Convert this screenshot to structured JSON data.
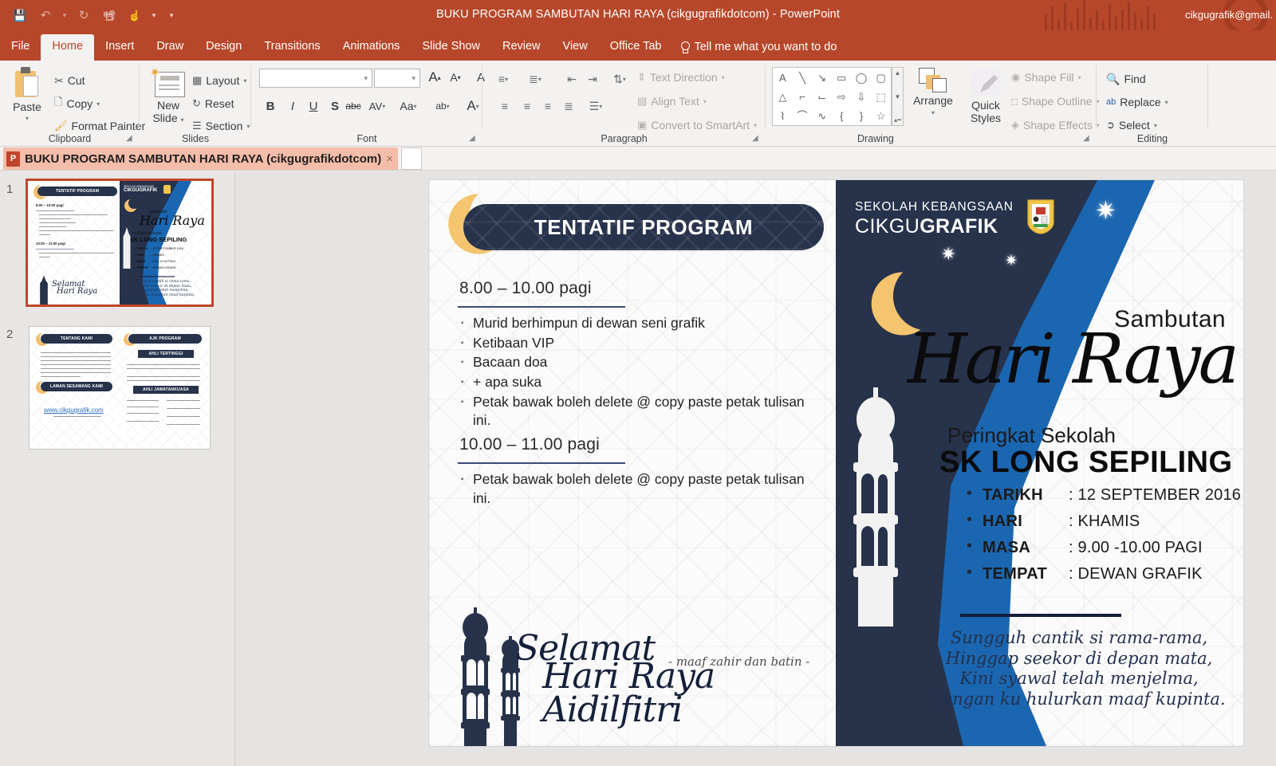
{
  "titlebar": {
    "document_title": "BUKU PROGRAM SAMBUTAN HARI RAYA (cikgugrafikdotcom)  -  PowerPoint",
    "account": "cikgugrafik@gmail.",
    "qat": [
      {
        "name": "save-icon",
        "glyph": "💾"
      },
      {
        "name": "undo-icon",
        "glyph": "↶"
      },
      {
        "name": "undo-dropdown-icon",
        "glyph": "▾"
      },
      {
        "name": "redo-icon",
        "glyph": "↻"
      },
      {
        "name": "start-slideshow-icon",
        "glyph": "⌨"
      },
      {
        "name": "touch-mode-icon",
        "glyph": "☝"
      },
      {
        "name": "touch-dropdown-icon",
        "glyph": "▾"
      },
      {
        "name": "customize-qat-icon",
        "glyph": "‗"
      }
    ]
  },
  "tabs": [
    {
      "label": "File",
      "active": false
    },
    {
      "label": "Home",
      "active": true
    },
    {
      "label": "Insert",
      "active": false
    },
    {
      "label": "Draw",
      "active": false
    },
    {
      "label": "Design",
      "active": false
    },
    {
      "label": "Transitions",
      "active": false
    },
    {
      "label": "Animations",
      "active": false
    },
    {
      "label": "Slide Show",
      "active": false
    },
    {
      "label": "Review",
      "active": false
    },
    {
      "label": "View",
      "active": false
    },
    {
      "label": "Office Tab",
      "active": false
    }
  ],
  "tellme": "Tell me what you want to do",
  "ribbon": {
    "clipboard": {
      "group_label": "Clipboard",
      "paste_label": "Paste",
      "cut_label": "Cut",
      "copy_label": "Copy",
      "format_painter_label": "Format Painter"
    },
    "slides": {
      "group_label": "Slides",
      "new_slide_label_line1": "New",
      "new_slide_label_line2": "Slide",
      "layout_label": "Layout",
      "reset_label": "Reset",
      "section_label": "Section"
    },
    "font": {
      "group_label": "Font",
      "font_name_value": "",
      "font_size_value": "",
      "increase_font_label": "A",
      "decrease_font_label": "A",
      "clear_formatting_label": "A",
      "bold_label": "B",
      "italic_label": "I",
      "underline_label": "U",
      "shadow_label": "S",
      "strikethrough_label": "abc",
      "character_spacing_label": "AV",
      "change_case_label": "Aa",
      "text_highlight_label": "ab",
      "font_color_label": "A"
    },
    "paragraph": {
      "group_label": "Paragraph",
      "text_direction_label": "Text Direction",
      "align_text_label": "Align Text",
      "convert_smartart_label": "Convert to SmartArt"
    },
    "drawing": {
      "group_label": "Drawing",
      "arrange_label": "Arrange",
      "quick_styles_line1": "Quick",
      "quick_styles_line2": "Styles",
      "shape_fill_label": "Shape Fill",
      "shape_outline_label": "Shape Outline",
      "shape_effects_label": "Shape Effects",
      "shapes": [
        "A",
        "╲",
        "↘",
        "▭",
        "◯",
        "▢",
        "△",
        "⌐",
        "⌙",
        "⇨",
        "⇩",
        "⬚",
        "⌇",
        "⌒",
        "∿",
        "{",
        "}",
        "☆"
      ]
    },
    "editing": {
      "group_label": "Editing",
      "find_label": "Find",
      "replace_label": "Replace",
      "select_label": "Select"
    }
  },
  "doctab": {
    "label": "BUKU PROGRAM SAMBUTAN HARI RAYA (cikgugrafikdotcom)",
    "icon_glyph": "P",
    "close_glyph": "×"
  },
  "thumbnails": [
    {
      "number": "1",
      "selected": true
    },
    {
      "number": "2",
      "selected": false
    }
  ],
  "slide": {
    "left_page": {
      "header_title": "TENTATIF PROGRAM",
      "sections": [
        {
          "time": "8.00 – 10.00 pagi",
          "items": [
            "Murid berhimpun di dewan seni grafik",
            "Ketibaan VIP",
            "Bacaan doa",
            "+ apa suka",
            "Petak bawak boleh delete @ copy paste petak tulisan ini."
          ]
        },
        {
          "time": "10.00 – 11.00 pagi",
          "items": [
            "Petak bawak boleh delete @ copy paste petak tulisan ini."
          ]
        }
      ],
      "greeting_line1": "Selamat",
      "greeting_line2": "Hari Raya Aidilfitri",
      "greeting_sub": "- maaf zahir dan batin -"
    },
    "right_page": {
      "school_line1": "SEKOLAH KEBANGSAAN",
      "school_line2_a": "CIKGU",
      "school_line2_b": "GRAFIK",
      "sambutan": "Sambutan",
      "hari_raya": "Hari Raya",
      "peringkat": "Peringkat Sekolah",
      "school_name": "SK LONG SEPILING",
      "details": [
        {
          "key": "TARIKH",
          "value": ": 12 SEPTEMBER 2016"
        },
        {
          "key": "HARI",
          "value": ":  KHAMIS"
        },
        {
          "key": "MASA",
          "value": ": 9.00 -10.00 PAGI"
        },
        {
          "key": "TEMPAT",
          "value": ": DEWAN GRAFIK"
        }
      ],
      "pantun": [
        "Sungguh cantik si rama-rama,",
        "Hinggap seekor di depan mata,",
        "Kini syawal telah menjelma,",
        "Tangan ku hulurkan maaf kupinta."
      ]
    }
  },
  "thumb2": {
    "header_left": "TENTANG KAMI",
    "header_right": "AJK PROGRAM",
    "sub_right": "AHLI TERTINGGI",
    "sub_right2": "AHLI JAWATANKUASA",
    "header_left2": "LAMAN SESAWANG KAMI",
    "website": "www.cikgugrafik.com"
  },
  "colors": {
    "ribbon_accent": "#b7472a",
    "navy": "#27324b",
    "blue": "#1b66b0",
    "gold": "#f2c06c",
    "tab_bg": "#f4bda9"
  }
}
